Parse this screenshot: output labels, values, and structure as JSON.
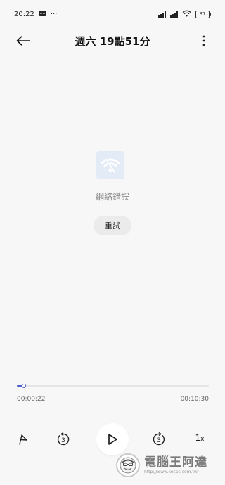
{
  "status": {
    "time": "20:22",
    "dots": "···",
    "battery": "87"
  },
  "header": {
    "title": "週六 19點51分"
  },
  "error": {
    "message": "網絡錯誤",
    "retry_label": "重試"
  },
  "player": {
    "current_time": "00:00:22",
    "total_time": "00:10:30",
    "progress": 0.035,
    "rewind_seconds": "3",
    "forward_seconds": "3",
    "speed": "1",
    "speed_unit": "x"
  },
  "watermark": {
    "title": "電腦王阿達",
    "url": "http://www.kocpc.com.tw/"
  },
  "colors": {
    "accent": "#4a5fd0",
    "error_icon_bg": "#e2ebf6"
  }
}
